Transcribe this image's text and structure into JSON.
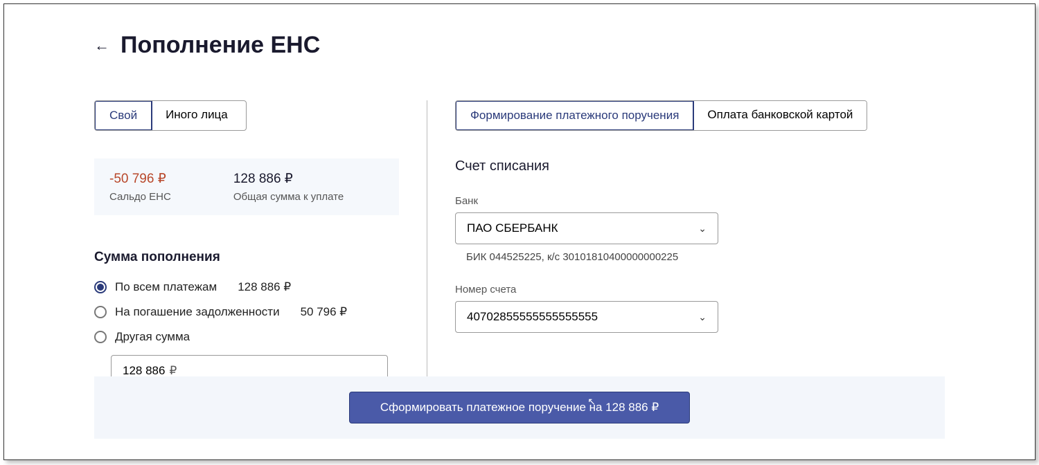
{
  "header": {
    "title": "Пополнение ЕНС"
  },
  "left": {
    "tabs": [
      "Свой",
      "Иного лица"
    ],
    "balance": {
      "neg_value": "-50 796 ₽",
      "neg_label": "Сальдо ЕНС",
      "total_value": "128 886 ₽",
      "total_label": "Общая сумма к уплате"
    },
    "amount_section_title": "Сумма пополнения",
    "radios": {
      "all_label": "По всем платежам",
      "all_amount": "128 886 ₽",
      "debt_label": "На погашение задолженности",
      "debt_amount": "50 796 ₽",
      "other_label": "Другая сумма"
    },
    "input_value": "128 886",
    "input_currency": "₽"
  },
  "right": {
    "tabs": [
      "Формирование платежного поручения",
      "Оплата банковской картой"
    ],
    "section_title": "Счет списания",
    "bank_label": "Банк",
    "bank_value": "ПАО СБЕРБАНК",
    "bank_details": "БИК 044525225, к/с 30101810400000000225",
    "account_label": "Номер счета",
    "account_value": "40702855555555555555"
  },
  "footer": {
    "button": "Сформировать платежное поручение на 128 886 ₽"
  }
}
